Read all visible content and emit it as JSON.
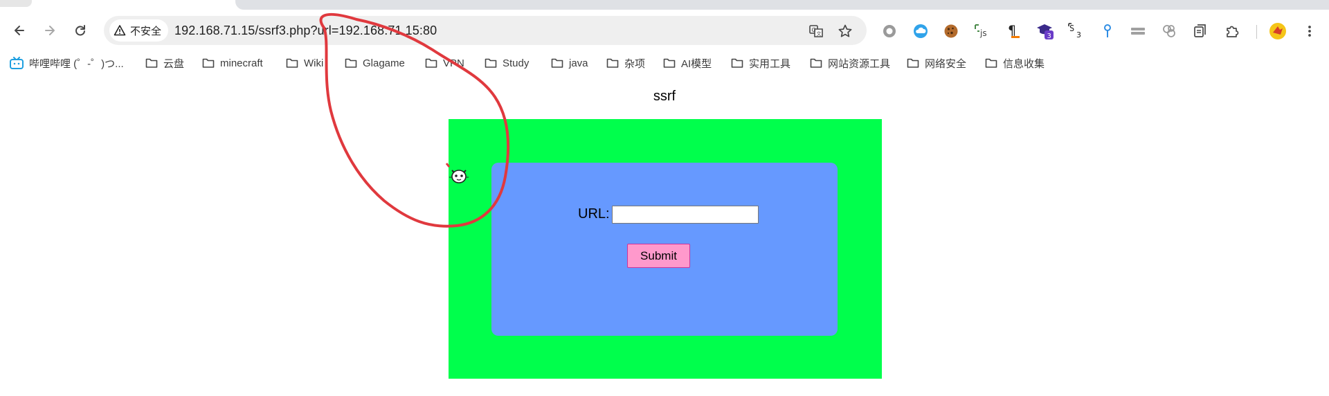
{
  "browser": {
    "address_bar": {
      "security_label": "不安全",
      "url": "192.168.71.15/ssrf3.php?url=192.168.71.15:80"
    },
    "extensions": [
      {
        "name": "circle-extension-icon",
        "label": ""
      },
      {
        "name": "cloud-extension-icon",
        "label": ""
      },
      {
        "name": "cookie-extension-icon",
        "label": ""
      },
      {
        "name": "js-extension-icon",
        "label": "js"
      },
      {
        "name": "pilcrow-extension-icon",
        "label": "¶"
      },
      {
        "name": "hat-extension-icon",
        "label": "3"
      },
      {
        "name": "s-extension-icon",
        "label": "3"
      },
      {
        "name": "pin-extension-icon",
        "label": ""
      },
      {
        "name": "bars-extension-icon",
        "label": ""
      },
      {
        "name": "rings-extension-icon",
        "label": ""
      },
      {
        "name": "copy-extension-icon",
        "label": ""
      },
      {
        "name": "puzzle-extension-icon",
        "label": ""
      },
      {
        "name": "profile-avatar-icon",
        "label": ""
      }
    ]
  },
  "bookmarks": [
    {
      "label": "哔哩哔哩 (゜-゜)つ...",
      "icon": "bilibili-icon"
    },
    {
      "label": "云盘",
      "icon": "folder-icon"
    },
    {
      "label": "minecraft",
      "icon": "folder-icon"
    },
    {
      "label": "Wiki",
      "icon": "folder-icon"
    },
    {
      "label": "Glagame",
      "icon": "folder-icon"
    },
    {
      "label": "VPN",
      "icon": "folder-icon"
    },
    {
      "label": "Study",
      "icon": "folder-icon"
    },
    {
      "label": "java",
      "icon": "folder-icon"
    },
    {
      "label": "杂项",
      "icon": "folder-icon"
    },
    {
      "label": "AI模型",
      "icon": "folder-icon"
    },
    {
      "label": "实用工具",
      "icon": "folder-icon"
    },
    {
      "label": "网站资源工具",
      "icon": "folder-icon"
    },
    {
      "label": "网络安全",
      "icon": "folder-icon"
    },
    {
      "label": "信息收集",
      "icon": "folder-icon"
    }
  ],
  "page": {
    "title": "ssrf",
    "form": {
      "url_label": "URL:",
      "url_value": "",
      "submit_label": "Submit"
    }
  },
  "colors": {
    "outer_box": "#00ff4c",
    "inner_box": "#6699ff",
    "submit_button": "#ff99cc",
    "annotation_stroke": "#e0393e"
  }
}
